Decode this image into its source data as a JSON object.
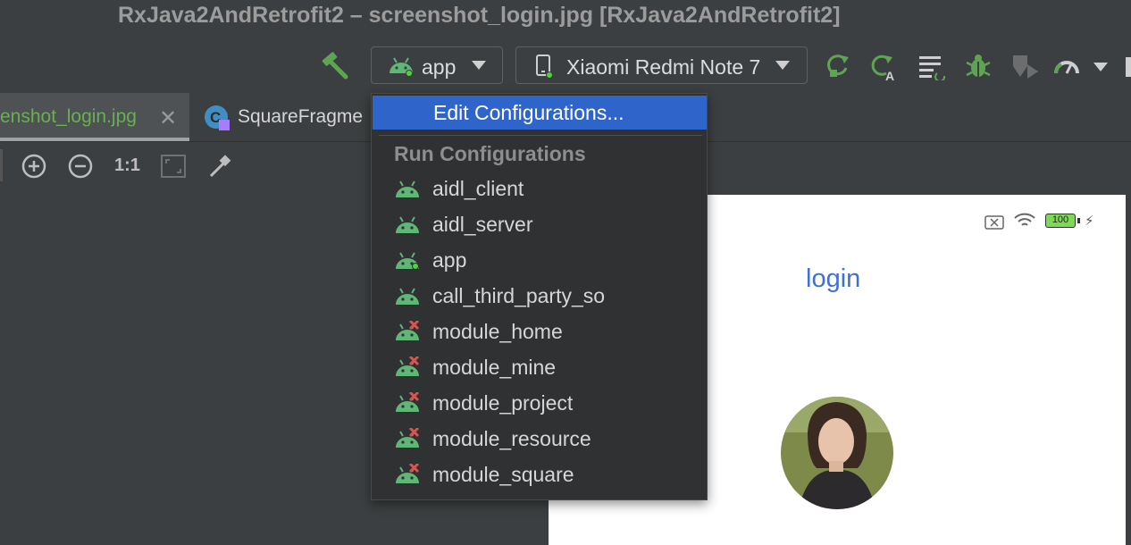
{
  "window": {
    "title": "RxJava2AndRetrofit2 – screenshot_login.jpg [RxJava2AndRetrofit2]"
  },
  "toolbar": {
    "run_config": {
      "label": "app",
      "icon": "android-icon"
    },
    "device": {
      "label": "Xiaomi Redmi Note 7",
      "icon": "phone-icon"
    },
    "icons": [
      "hammer-icon",
      "apply-changes-icon",
      "apply-code-changes-icon",
      "sync-icon",
      "debug-icon",
      "attach-debugger-icon",
      "profiler-icon",
      "more-icon"
    ]
  },
  "tabs": [
    {
      "label": "enshot_login.jpg",
      "active": true
    },
    {
      "label": "SquareFragme",
      "active": false
    }
  ],
  "image_tools": [
    "zoom-in-icon",
    "zoom-out-icon",
    "actual-size-icon",
    "fit-icon",
    "color-picker-icon"
  ],
  "image_tools_text": {
    "actual_size": "1:1"
  },
  "dropdown": {
    "edit_label": "Edit Configurations...",
    "header": "Run Configurations",
    "items": [
      {
        "label": "aidl_client",
        "status": "ok"
      },
      {
        "label": "aidl_server",
        "status": "ok"
      },
      {
        "label": "app",
        "status": "running"
      },
      {
        "label": "call_third_party_so",
        "status": "ok"
      },
      {
        "label": "module_home",
        "status": "error"
      },
      {
        "label": "module_mine",
        "status": "error"
      },
      {
        "label": "module_project",
        "status": "error"
      },
      {
        "label": "module_resource",
        "status": "error"
      },
      {
        "label": "module_square",
        "status": "error"
      }
    ]
  },
  "preview": {
    "status_bar": {
      "battery": "100"
    },
    "login_text": "login"
  },
  "colors": {
    "android_green": "#5fb776",
    "error_red": "#d9534f",
    "selection_blue": "#2f65ca",
    "login_blue": "#3f70d2",
    "active_tab_text": "#6aaf52"
  }
}
